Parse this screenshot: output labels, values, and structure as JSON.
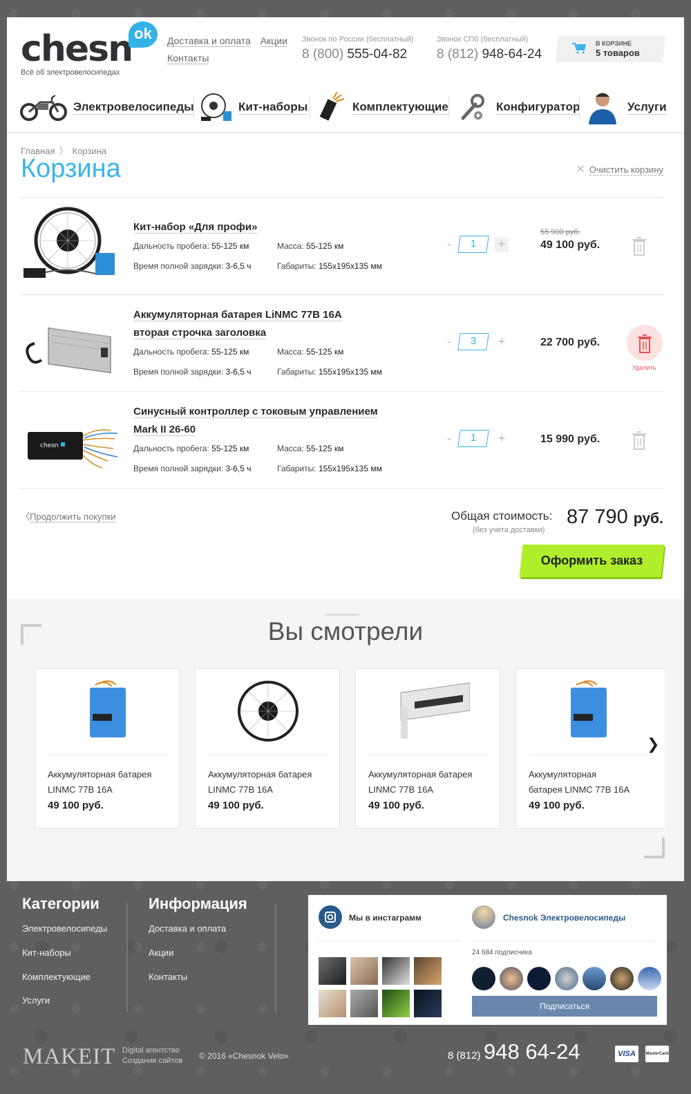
{
  "header": {
    "logo_text": "chesn",
    "logo_badge": "ok",
    "logo_tagline": "Всё об электровелосипедах",
    "links": [
      "Доставка и оплата",
      "Акции",
      "Контакты"
    ],
    "phones": [
      {
        "caption": "Звонок по России (бесплатный)",
        "code": "8 (800)",
        "number": "555-04-82"
      },
      {
        "caption": "Звонок СПб (бесплатный)",
        "code": "8 (812)",
        "number": "948-64-24"
      }
    ],
    "cart": {
      "caption": "в корзине",
      "count": "5 товаров"
    }
  },
  "nav": [
    {
      "label": "Электровелосипеды",
      "icon": "ebike-icon"
    },
    {
      "label": "Кит-наборы",
      "icon": "kit-icon"
    },
    {
      "label": "Комплектующие",
      "icon": "components-icon"
    },
    {
      "label": "Конфигуратор",
      "icon": "wrench-icon"
    },
    {
      "label": "Услуги",
      "icon": "services-icon"
    }
  ],
  "breadcrumb": [
    "Главная",
    "Корзина"
  ],
  "page_title": "Корзина",
  "clear_cart": "Очистить корзину",
  "spec_labels": {
    "range": "Дальность пробега:",
    "mass": "Масса:",
    "charge": "Время полной зарядки:",
    "size": "Габариты:"
  },
  "items": [
    {
      "title": "Кит-набор «Для профи»",
      "title2": "",
      "range": "55-125 км",
      "mass": "55-125 км",
      "charge": "3-6,5 ч",
      "size": "155x195x135 мм",
      "qty": "1",
      "old_price": "55 900 руб.",
      "price": "49 100 руб."
    },
    {
      "title": "Аккумуляторная батарея LiNMC 77В 16А",
      "title2": "вторая строчка заголовка",
      "range": "55-125 км",
      "mass": "55-125 км",
      "charge": "3-6,5 ч",
      "size": "155x195x135 мм",
      "qty": "3",
      "old_price": "",
      "price": "22 700 руб.",
      "delete_label": "Удалить"
    },
    {
      "title": "Синусный контроллер с токовым управлением",
      "title2": "Mark II 26-60",
      "range": "55-125 км",
      "mass": "55-125 км",
      "charge": "3-6,5 ч",
      "size": "155x195x135 мм",
      "qty": "1",
      "old_price": "",
      "price": "15 990 руб."
    }
  ],
  "continue_shopping": "Продолжить покупки",
  "total": {
    "label": "Общая стоимость:",
    "note": "(без учета доставки)",
    "value": "87 790",
    "currency": "руб."
  },
  "order_button": "Оформить заказ",
  "viewed": {
    "title": "Вы смотрели",
    "cards": [
      {
        "name": "Аккумуляторная батарея LINMC 77В 16А",
        "price": "49 100 руб."
      },
      {
        "name": "Аккумуляторная батарея LINMC 77В 16А",
        "price": "49 100 руб."
      },
      {
        "name": "Аккумуляторная батарея LINMC 77В 16А",
        "price": "49 100 руб."
      },
      {
        "name": "Аккумуляторная батарея LINMC 77В 16А",
        "price": "49 100 руб."
      }
    ]
  },
  "footer": {
    "categories_title": "Категории",
    "categories": [
      "Электровелосипеды",
      "Кит-наборы",
      "Комплектующие",
      "Услуги"
    ],
    "info_title": "Информация",
    "info": [
      "Доставка и оплата",
      "Акции",
      "Контакты"
    ],
    "instagram_title": "Мы в инстаграмм",
    "vk_title": "Chesnok Электровелосипеды",
    "vk_subscribers": "24 684 подписчика",
    "vk_subscribe": "Подписаться",
    "agency_name": "MAKEIT",
    "agency_line1": "Digital агентство",
    "agency_line2": "Создание сайтов",
    "copyright": "© 2016 «Chesnok Velo»",
    "phone_code": "8 (812)",
    "phone_number": "948 64-24",
    "payments": [
      "VISA",
      "MasterCard"
    ]
  },
  "colors": {
    "accent": "#3bb3ea",
    "order_button": "#b0ee2c",
    "delete": "#e05555",
    "vk": "#6a88ad"
  }
}
